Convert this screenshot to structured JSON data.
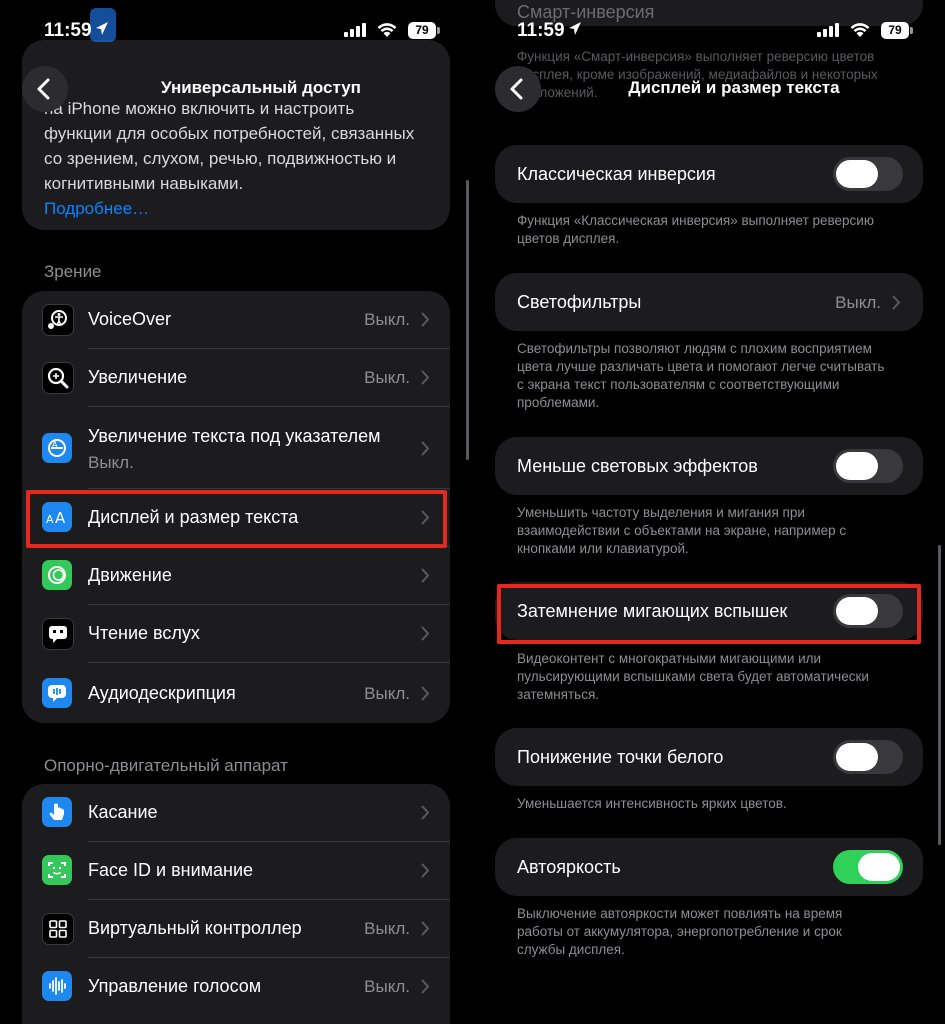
{
  "status": {
    "time": "11:59",
    "battery": "79"
  },
  "left": {
    "title": "Универсальный доступ",
    "intro_text": "на iPhone можно включить и настроить функции для особых потребностей, связанных со зрением, слухом, речью, подвижностью и когнитивными навыками.",
    "intro_link": "Подробнее…",
    "section_vision": "Зрение",
    "vision_items": [
      {
        "label": "VoiceOver",
        "value": "Выкл."
      },
      {
        "label": "Увеличение",
        "value": "Выкл."
      },
      {
        "label": "Увеличение текста под указателем",
        "sub": "Выкл."
      },
      {
        "label": "Дисплей и размер текста",
        "value": ""
      },
      {
        "label": "Движение",
        "value": ""
      },
      {
        "label": "Чтение вслух",
        "value": ""
      },
      {
        "label": "Аудиодескрипция",
        "value": "Выкл."
      }
    ],
    "section_motor": "Опорно-двигательный аппарат",
    "motor_items": [
      {
        "label": "Касание",
        "value": ""
      },
      {
        "label": "Face ID и внимание",
        "value": ""
      },
      {
        "label": "Виртуальный контроллер",
        "value": "Выкл."
      },
      {
        "label": "Управление голосом",
        "value": "Выкл."
      }
    ]
  },
  "right": {
    "title": "Дисплей и размер текста",
    "top_partial": "Смарт-инверсия",
    "top_partial_text": "Функция «Смарт-инверсия» выполняет реверсию цветов дисплея, кроме изображений, медиафайлов и некоторых приложений.",
    "settings": [
      {
        "label": "Классическая инверсия",
        "type": "toggle",
        "on": false,
        "footer": "Функция «Классическая инверсия» выполняет реверсию цветов дисплея."
      },
      {
        "label": "Светофильтры",
        "type": "link",
        "value": "Выкл.",
        "footer": "Светофильтры позволяют людям с плохим восприятием цвета лучше различать цвета и помогают легче считывать с экрана текст пользователям с соответствующими проблемами."
      },
      {
        "label": "Меньше световых эффектов",
        "type": "toggle",
        "on": false,
        "footer": "Уменьшить частоту выделения и мигания при взаимодействии с объектами на экране, например с кнопками или клавиатурой."
      },
      {
        "label": "Затемнение мигающих вспышек",
        "type": "toggle",
        "on": false,
        "footer": "Видеоконтент с многократными мигающими или пульсирующими вспышками света будет автоматически затемняться."
      },
      {
        "label": "Понижение точки белого",
        "type": "toggle",
        "on": false,
        "footer": "Уменьшается интенсивность ярких цветов."
      },
      {
        "label": "Автояркость",
        "type": "toggle",
        "on": true,
        "footer": "Выключение автояркости может повлиять на время работы от аккумулятора, энергопотребление и срок службы дисплея."
      }
    ]
  },
  "colors": {
    "accent": "#0a84ff",
    "highlight": "#e5281e",
    "toggle_on": "#30d158"
  }
}
